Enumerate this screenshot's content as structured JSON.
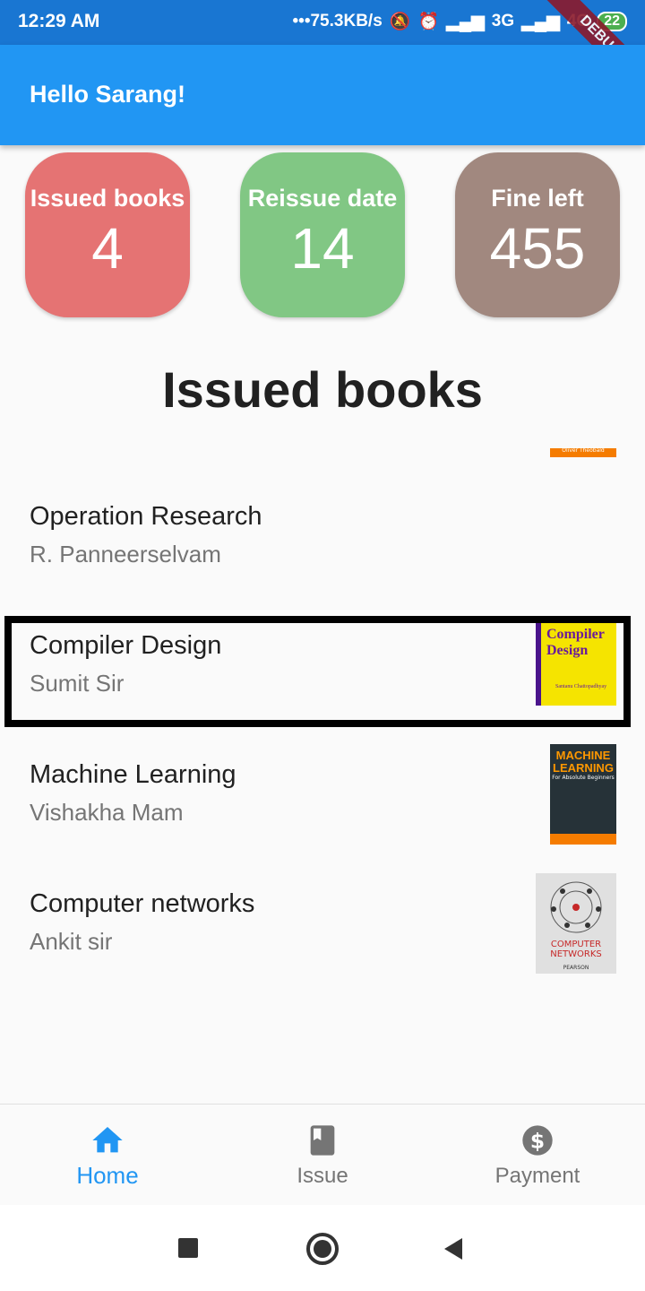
{
  "status_bar": {
    "time": "12:29 AM",
    "network_speed": "•••75.3KB/s",
    "network_3g": "3G",
    "network_4g": "4G",
    "battery": "22",
    "debug_banner": "DEBUG"
  },
  "app_bar": {
    "title": "Hello Sarang!"
  },
  "stats": [
    {
      "label": "Issued books",
      "value": "4",
      "color": "#e57373"
    },
    {
      "label": "Reissue date",
      "value": "14",
      "color": "#81c784"
    },
    {
      "label": "Fine left",
      "value": "455",
      "color": "#a1887f"
    }
  ],
  "section_title": "Issued books",
  "books": [
    {
      "title": "Operation Research",
      "author": "R. Panneerselvam"
    },
    {
      "title": "Compiler Design",
      "author": "Sumit Sir",
      "cover_title": "Compiler Design",
      "cover_author": "Santanu Chattopadhyay"
    },
    {
      "title": "Machine Learning",
      "author": "Vishakha Mam",
      "cover_title": "MACHINE LEARNING",
      "cover_sub": "For Absolute Beginners",
      "cover_author": "Oliver Theobald"
    },
    {
      "title": "Computer networks",
      "author": "Ankit sir",
      "cover_title": "COMPUTER NETWORKS",
      "cover_publisher": "PEARSON"
    }
  ],
  "partial_cover_text": "Oliver Theobald",
  "bottom_nav": [
    {
      "label": "Home",
      "icon": "home-icon",
      "active": true
    },
    {
      "label": "Issue",
      "icon": "book-icon",
      "active": false
    },
    {
      "label": "Payment",
      "icon": "dollar-icon",
      "active": false
    }
  ],
  "colors": {
    "accent": "#2196f3",
    "status_bar": "#1976d2",
    "inactive": "#757575"
  }
}
